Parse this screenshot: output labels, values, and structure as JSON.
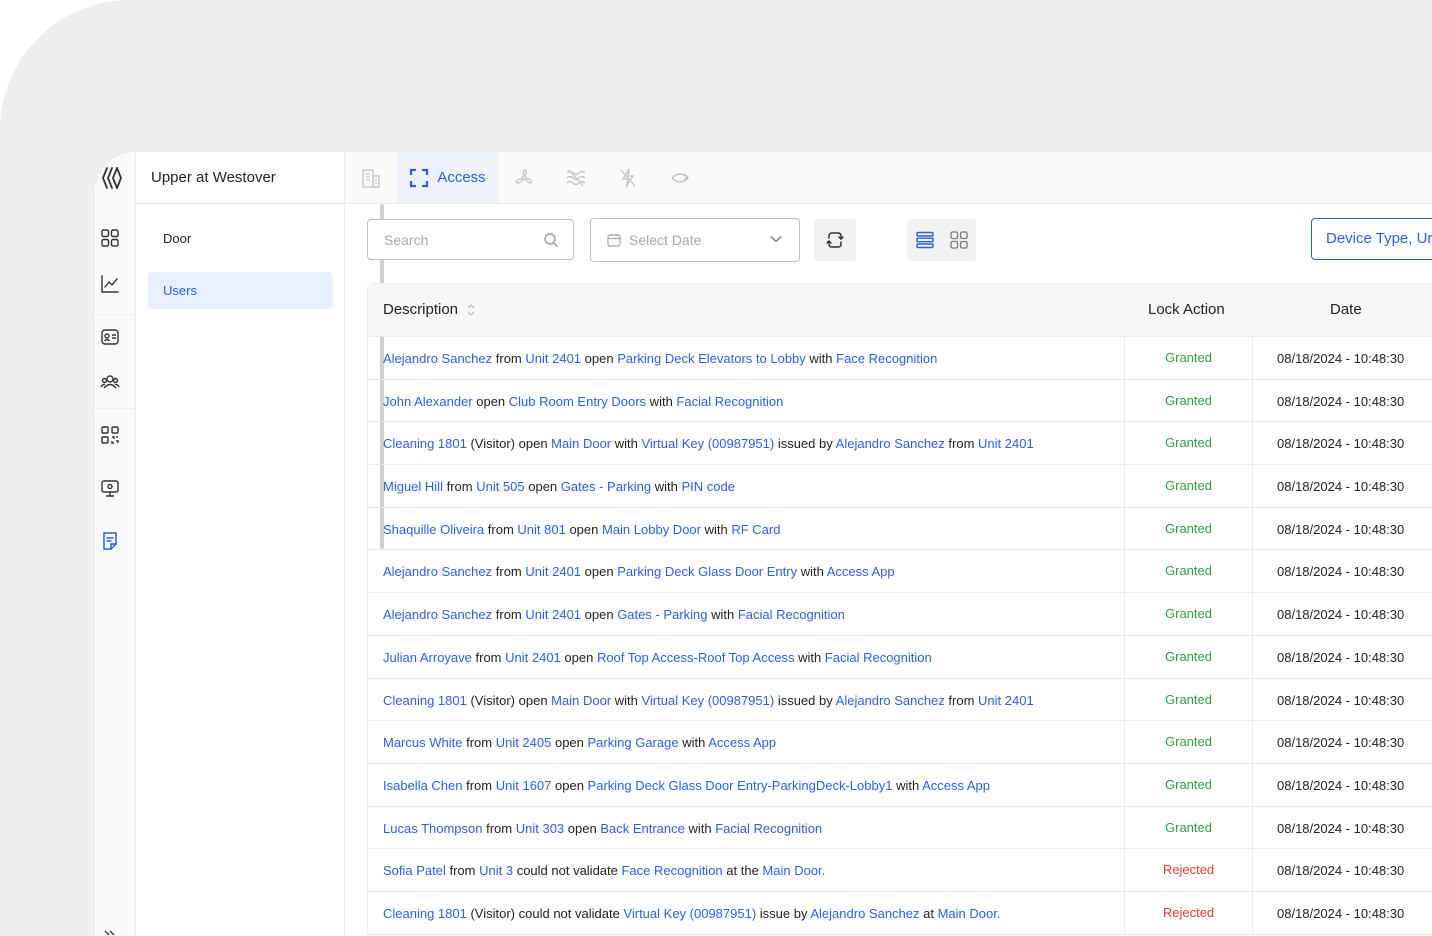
{
  "app": {
    "site_name": "Upper at Westover"
  },
  "rail": {
    "icons": [
      "dashboard-icon",
      "analytics-chart-icon",
      "id-card-icon",
      "users-group-icon",
      "qr-code-icon",
      "monitor-icon",
      "notes-icon"
    ],
    "active_icon": "notes-icon"
  },
  "submenu": {
    "items": [
      {
        "label": "Door",
        "active": false
      },
      {
        "label": "Users",
        "active": true
      }
    ]
  },
  "tabs": [
    {
      "icon": "building-icon",
      "label": ""
    },
    {
      "icon": "access-scan-icon",
      "label": "Access",
      "active": true
    },
    {
      "icon": "fan-icon",
      "label": ""
    },
    {
      "icon": "waves-icon",
      "label": ""
    },
    {
      "icon": "lightning-icon",
      "label": ""
    },
    {
      "icon": "sync-icon",
      "label": ""
    }
  ],
  "toolbar": {
    "search_placeholder": "Search",
    "date_placeholder": "Select Date",
    "device_filter_label": "Device Type, Ur"
  },
  "table": {
    "columns": {
      "description": "Description",
      "lock_action": "Lock Action",
      "date": "Date"
    },
    "rows": [
      {
        "parts": [
          {
            "t": "Alejandro Sanchez",
            "l": true
          },
          {
            "t": " from "
          },
          {
            "t": "Unit 2401",
            "l": true
          },
          {
            "t": " open "
          },
          {
            "t": "Parking Deck Elevators to Lobby",
            "l": true
          },
          {
            "t": " with "
          },
          {
            "t": "Face Recognition",
            "l": true
          }
        ],
        "action": "Granted",
        "date": "08/18/2024 - 10:48:30"
      },
      {
        "parts": [
          {
            "t": "John Alexander",
            "l": true
          },
          {
            "t": " open "
          },
          {
            "t": "Club Room Entry Doors",
            "l": true
          },
          {
            "t": " with "
          },
          {
            "t": "Facial Recognition",
            "l": true
          }
        ],
        "action": "Granted",
        "date": "08/18/2024 - 10:48:30"
      },
      {
        "parts": [
          {
            "t": "Cleaning 1801",
            "l": true
          },
          {
            "t": " (Visitor) open "
          },
          {
            "t": "Main Door",
            "l": true
          },
          {
            "t": " with "
          },
          {
            "t": "Virtual Key (00987951)",
            "l": true
          },
          {
            "t": " issued by "
          },
          {
            "t": "Alejandro Sanchez",
            "l": true
          },
          {
            "t": " from "
          },
          {
            "t": "Unit 2401",
            "l": true
          }
        ],
        "action": "Granted",
        "date": "08/18/2024 - 10:48:30"
      },
      {
        "parts": [
          {
            "t": "Miguel Hill",
            "l": true
          },
          {
            "t": " from "
          },
          {
            "t": "Unit 505",
            "l": true
          },
          {
            "t": " open "
          },
          {
            "t": "Gates - Parking",
            "l": true
          },
          {
            "t": " with "
          },
          {
            "t": "PIN code",
            "l": true
          }
        ],
        "action": "Granted",
        "date": "08/18/2024 - 10:48:30"
      },
      {
        "parts": [
          {
            "t": "Shaquille Oliveira",
            "l": true
          },
          {
            "t": " from "
          },
          {
            "t": "Unit 801",
            "l": true
          },
          {
            "t": " open "
          },
          {
            "t": "Main Lobby Door",
            "l": true
          },
          {
            "t": " with "
          },
          {
            "t": "RF Card",
            "l": true
          }
        ],
        "action": "Granted",
        "date": "08/18/2024 - 10:48:30"
      },
      {
        "parts": [
          {
            "t": "Alejandro Sanchez",
            "l": true
          },
          {
            "t": " from "
          },
          {
            "t": "Unit 2401",
            "l": true
          },
          {
            "t": " open "
          },
          {
            "t": "Parking Deck Glass Door Entry",
            "l": true
          },
          {
            "t": " with "
          },
          {
            "t": "Access App",
            "l": true
          }
        ],
        "action": "Granted",
        "date": "08/18/2024 - 10:48:30"
      },
      {
        "parts": [
          {
            "t": "Alejandro Sanchez",
            "l": true
          },
          {
            "t": " from "
          },
          {
            "t": "Unit 2401",
            "l": true
          },
          {
            "t": " open "
          },
          {
            "t": "Gates - Parking",
            "l": true
          },
          {
            "t": " with "
          },
          {
            "t": "Facial Recognition",
            "l": true
          }
        ],
        "action": "Granted",
        "date": "08/18/2024 - 10:48:30"
      },
      {
        "parts": [
          {
            "t": "Julian Arroyave",
            "l": true
          },
          {
            "t": " from "
          },
          {
            "t": "Unit 2401",
            "l": true
          },
          {
            "t": " open "
          },
          {
            "t": "Roof Top Access-Roof Top Access",
            "l": true
          },
          {
            "t": " with "
          },
          {
            "t": "Facial Recognition",
            "l": true
          }
        ],
        "action": "Granted",
        "date": "08/18/2024 - 10:48:30"
      },
      {
        "parts": [
          {
            "t": "Cleaning 1801",
            "l": true
          },
          {
            "t": " (Visitor) open "
          },
          {
            "t": "Main Door",
            "l": true
          },
          {
            "t": " with "
          },
          {
            "t": "Virtual Key (00987951)",
            "l": true
          },
          {
            "t": " issued by "
          },
          {
            "t": "Alejandro Sanchez",
            "l": true
          },
          {
            "t": " from "
          },
          {
            "t": "Unit 2401",
            "l": true
          }
        ],
        "action": "Granted",
        "date": "08/18/2024 - 10:48:30"
      },
      {
        "parts": [
          {
            "t": "Marcus White",
            "l": true
          },
          {
            "t": " from "
          },
          {
            "t": "Unit 2405",
            "l": true
          },
          {
            "t": " open "
          },
          {
            "t": "Parking Garage",
            "l": true
          },
          {
            "t": " with "
          },
          {
            "t": "Access App",
            "l": true
          }
        ],
        "action": "Granted",
        "date": "08/18/2024 - 10:48:30"
      },
      {
        "parts": [
          {
            "t": "Isabella Chen",
            "l": true
          },
          {
            "t": " from "
          },
          {
            "t": "Unit 1607",
            "l": true
          },
          {
            "t": " open "
          },
          {
            "t": "Parking Deck Glass Door Entry-ParkingDeck-Lobby1",
            "l": true
          },
          {
            "t": " with "
          },
          {
            "t": "Access App",
            "l": true
          }
        ],
        "action": "Granted",
        "date": "08/18/2024 - 10:48:30"
      },
      {
        "parts": [
          {
            "t": "Lucas Thompson",
            "l": true
          },
          {
            "t": " from "
          },
          {
            "t": "Unit 303",
            "l": true
          },
          {
            "t": " open "
          },
          {
            "t": "Back Entrance",
            "l": true
          },
          {
            "t": " with "
          },
          {
            "t": "Facial Recognition",
            "l": true
          }
        ],
        "action": "Granted",
        "date": "08/18/2024 - 10:48:30"
      },
      {
        "parts": [
          {
            "t": "Sofia Patel",
            "l": true
          },
          {
            "t": " from "
          },
          {
            "t": "Unit 3",
            "l": true
          },
          {
            "t": " could not validate "
          },
          {
            "t": "Face Recognition",
            "l": true
          },
          {
            "t": " at the "
          },
          {
            "t": "Main Door.",
            "l": true
          }
        ],
        "action": "Rejected",
        "date": "08/18/2024 - 10:48:30"
      },
      {
        "parts": [
          {
            "t": "Cleaning 1801",
            "l": true
          },
          {
            "t": " (Visitor) could not validate "
          },
          {
            "t": "Virtual Key (00987951)",
            "l": true
          },
          {
            "t": " issue by "
          },
          {
            "t": "Alejandro Sanchez",
            "l": true
          },
          {
            "t": " at "
          },
          {
            "t": "Main Door.",
            "l": true
          }
        ],
        "action": "Rejected",
        "date": "08/18/2024 - 10:48:30"
      }
    ]
  },
  "colors": {
    "accent": "#2b5fe0",
    "granted": "#2ea043",
    "rejected": "#e53935"
  }
}
